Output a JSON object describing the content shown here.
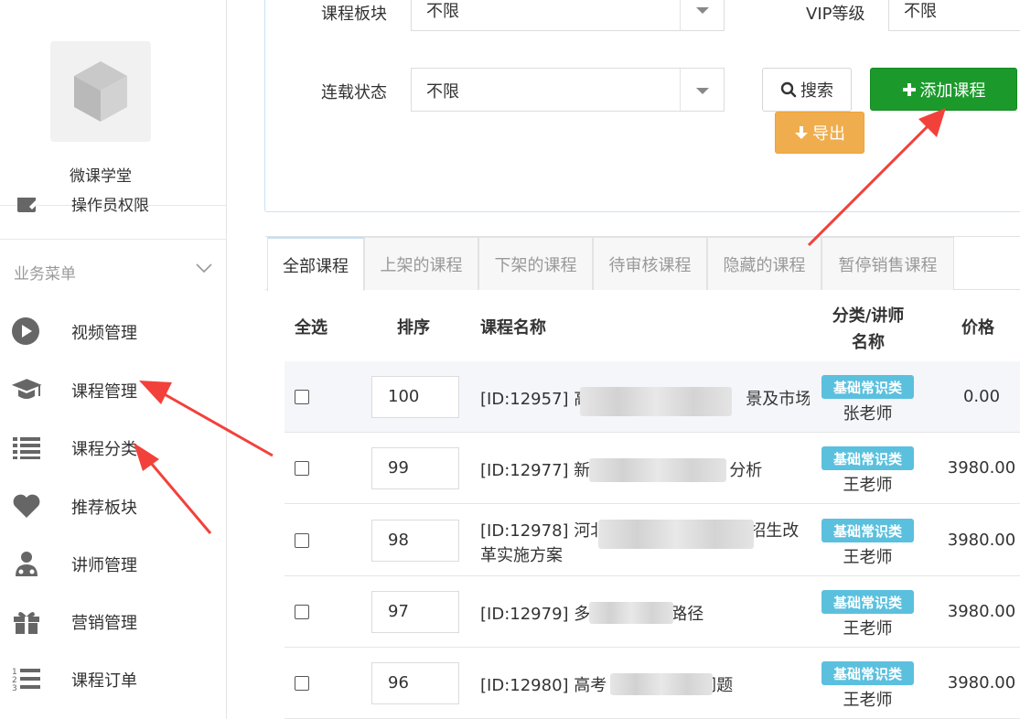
{
  "sidebar": {
    "app_name": "微课学堂",
    "partial_item": "操作员权限",
    "menu_title": "业务菜单",
    "items": [
      {
        "label": "视频管理",
        "icon": "play-circle-icon"
      },
      {
        "label": "课程管理",
        "icon": "graduation-cap-icon"
      },
      {
        "label": "课程分类",
        "icon": "list-icon"
      },
      {
        "label": "推荐板块",
        "icon": "heart-icon"
      },
      {
        "label": "讲师管理",
        "icon": "user-md-icon"
      },
      {
        "label": "营销管理",
        "icon": "gift-icon"
      },
      {
        "label": "课程订单",
        "icon": "ordered-list-icon"
      }
    ]
  },
  "filters": {
    "section_label": "课程板块",
    "section_value": "不限",
    "vip_label": "VIP等级",
    "vip_value": "不限",
    "status_label": "连载状态",
    "status_value": "不限",
    "search_label": "搜索",
    "add_label": "添加课程",
    "export_label": "导出"
  },
  "tabs": [
    "全部课程",
    "上架的课程",
    "下架的课程",
    "待审核课程",
    "隐藏的课程",
    "暂停销售课程"
  ],
  "table": {
    "headers": {
      "select": "全选",
      "sort": "排序",
      "name": "课程名称",
      "category_line1": "分类/讲师",
      "category_line2": "名称",
      "price": "价格"
    },
    "rows": [
      {
        "sort": "100",
        "name_line1": "[ID:12957] 高",
        "name_tail": "景及市场",
        "name_line2": "",
        "category": "基础常识类",
        "teacher": "张老师",
        "price": "0.00"
      },
      {
        "sort": "99",
        "name_line1": "[ID:12977] 新",
        "name_tail": "分析",
        "name_line2": "",
        "category": "基础常识类",
        "teacher": "王老师",
        "price": "3980.00"
      },
      {
        "sort": "98",
        "name_line1": "[ID:12978] 河北",
        "name_tail": "高考考试和招生改",
        "name_line2": "革实施方案",
        "category": "基础常识类",
        "teacher": "王老师",
        "price": "3980.00"
      },
      {
        "sort": "97",
        "name_line1": "[ID:12979] 多",
        "name_tail": "路径",
        "name_line2": "",
        "category": "基础常识类",
        "teacher": "王老师",
        "price": "3980.00"
      },
      {
        "sort": "96",
        "name_line1": "[ID:12980] 高考",
        "name_tail": "问题",
        "name_line2": "",
        "category": "基础常识类",
        "teacher": "王老师",
        "price": "3980.00"
      }
    ]
  },
  "colors": {
    "add_button": "#1b9a2b",
    "export_button": "#f0ad4e",
    "badge": "#5bc0de",
    "annotation_arrow": "#f2413b"
  }
}
